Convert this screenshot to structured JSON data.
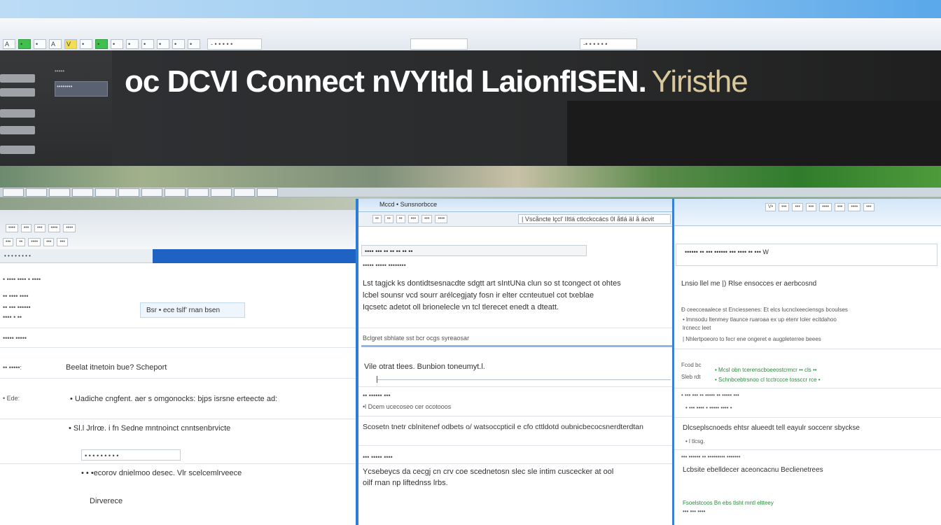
{
  "banner": {
    "title_main": "oc DCVI Connect nVYItld LaionfISEN.",
    "title_tail": " Yiristhe"
  },
  "topbar": {
    "buttons": [
      "A",
      "•",
      "•",
      "A",
      "V",
      "•",
      "•",
      "•",
      "•",
      "•",
      "•",
      "•",
      "•"
    ],
    "field_left": "- • • • • •",
    "field_right": "-• • • • • •"
  },
  "sidebar": {
    "top_label": "•••••",
    "box_label": "••••••••"
  },
  "left": {
    "tabs": [
      "••••",
      "•••",
      "•••",
      "••••",
      "••••"
    ],
    "tabs2": [
      "•••",
      "••",
      "••••",
      "•••",
      "•••"
    ],
    "sub": "• • • • • • • •",
    "box": "Bsr • ece tslf’ rnan bsen",
    "row1": "Beelat itnetoin bue? Scheport",
    "row1_label": "•• •••••:",
    "row2": "• Uadiche cngfent. aer s omgonocks: bjps isrsne erteecte ad:",
    "row2_label": "• Ede:",
    "row3": "• Sl.l Jrlrœ. i fn Sedne mntnoinct cnntsenbrvicte",
    "input": "• • • • • • • • •",
    "row4": "• • •ecorov dnielmoo desec. Vlr scelcemlrveece",
    "row5": "Dirverece"
  },
  "middle": {
    "window_title": "Mccd • Sunsnorbcce",
    "uri": "| Vscåncte lçcl' IItlá ctlcckccács 0l åtlá äI å ácvit",
    "toolbar": [
      "••",
      "••",
      "••",
      "•••",
      "•••",
      "••••"
    ],
    "bar": "•••• ••• •• •• •• •• ••",
    "sub": "••••• ••••• ••••••••",
    "para1": "Lst tagjck ks dontidtsesnacdte sdgtt art sIntUNa clun so st tcongect ot ohtes",
    "para2": "lcbel sounsr vcd sourr arélcegjaty fosn ir elter ccnteutuel cot txeblae",
    "para3": "Iqcsetc adetot oll brionelecle vn tcl tlerecet enedt a dteatt.",
    "section": "Bclgret sbhlate sst bcr ocgs syreaosar",
    "row1": "Vile otrat tlees. Bunbion toneumyt.l.",
    "label2": "•• •••••• •••",
    "label3": "•l Dcem ucecoseo cer ocotooos",
    "row2": "Scosetn tnetr cblnitenef odbets o/ watsoccpticil e cfo cttldotd oubnicbecocsnerdterdtan",
    "label4": "••• ••••• ••••",
    "row3": "Ycsebeycs da cecgj cn crv coe scednetosn slec sle intim cuscecker at ool",
    "row4": "oilf rnan np liftednss lrbs."
  },
  "right": {
    "tabs": [
      "V•",
      "•••",
      "•••",
      "•••",
      "••••",
      "•••",
      "••••",
      "•••"
    ],
    "bar": "•••••• •• ••• •••••• ••• •••• •• ••• W",
    "line1": "Lnsio llel me |) Rlse ensocces er aerbcosnd",
    "line2": "Ð ceecceaalece st Enciessenes: Et elcs lucnclxeeciensgs bcoulses",
    "line3": "• lmnsodu ltenmey tlaunce ruaroaa ex up etenr loler ecitdahoo",
    "line3b": "lrcnecc leet",
    "line4": "| Nhlertpoeoro to fecr ene ongeret e augpleterree beees",
    "small1": "Fcod bc",
    "green1": "• Mcsl obn tcerenscboeeostcrmcr •• cls ••",
    "small2": "Sleb rdt",
    "green2": "• Schnbcebtrsnoo cl tcctrccce tossccr rce •",
    "small3": "• ••• ••• •• ••••• •• ••••• •••",
    "small4": "• ••• •••• • ••••• •••• •",
    "line5": "Dlcseplscnoeds ehtsr alueedt tell eayulr soccenr sbyckse",
    "line5b": "• l tlcsg.",
    "small5": "••• •••••• •• ••••••••• •••••••",
    "line6": "Lcbsite ebelldecer aceoncacnu Beclienetrees",
    "green3": "Fsoelstcoos Bn ebs tlsht mntl eltteey",
    "small6": "••• ••• ••••"
  }
}
